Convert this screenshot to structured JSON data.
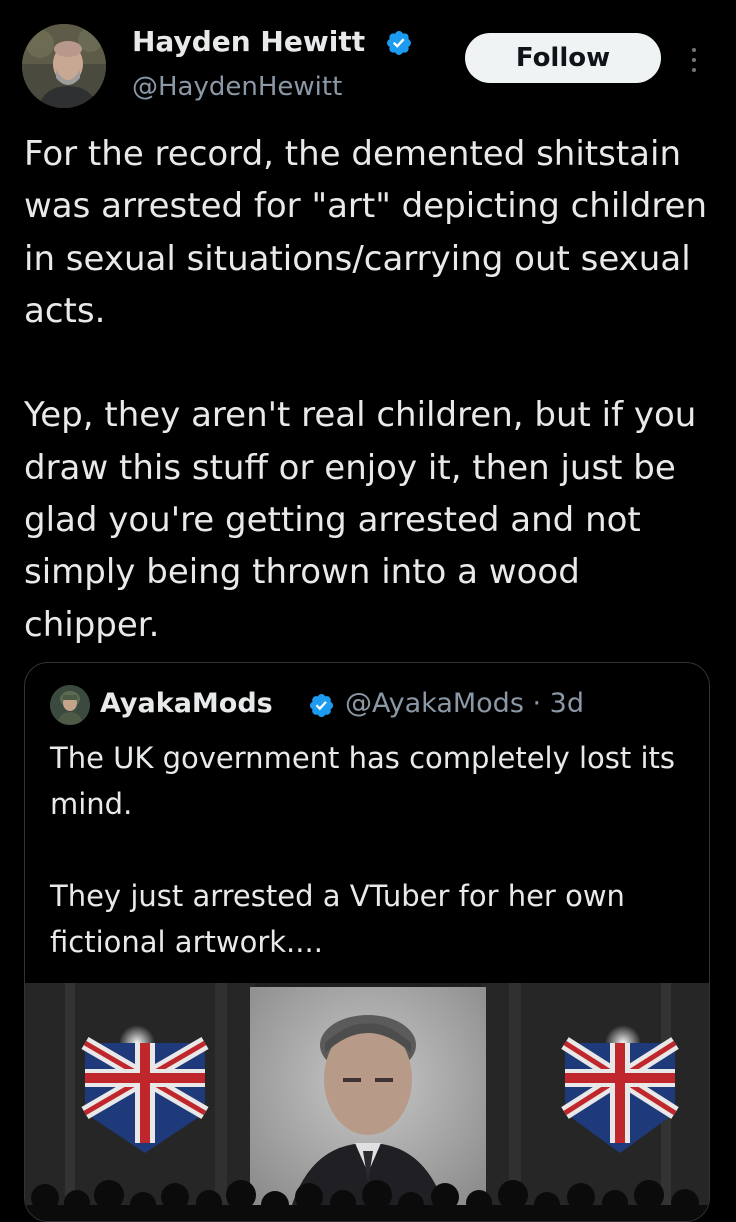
{
  "tweet": {
    "author": {
      "display_name": "Hayden Hewitt",
      "handle": "@HaydenHewitt",
      "verified": true
    },
    "follow_label": "Follow",
    "paragraphs": [
      "For the record, the demented shitstain was arrested for \"art\" depicting children in sexual situations/carrying out sexual acts.",
      "Yep, they aren't real children, but if you draw this stuff or enjoy it, then just be glad you're getting arrested and not simply being thrown into a wood chipper."
    ]
  },
  "quoted_tweet": {
    "author": {
      "display_name": "AyakaMods",
      "handle_time": "@AyakaMods · 3d",
      "verified": true
    },
    "paragraphs": [
      "The UK government has completely lost its mind.",
      "They just arrested a VTuber for her own fictional artwork...."
    ],
    "media": {
      "icons": [
        "portrait-screen",
        "union-jack-flag",
        "union-jack-flag",
        "crowd"
      ]
    }
  },
  "colors": {
    "background": "#000000",
    "text_primary": "#e7e9ea",
    "text_secondary": "#8b98a5",
    "verified_blue": "#1d9bf0",
    "follow_bg": "#eff3f4",
    "border": "#2f3336"
  }
}
